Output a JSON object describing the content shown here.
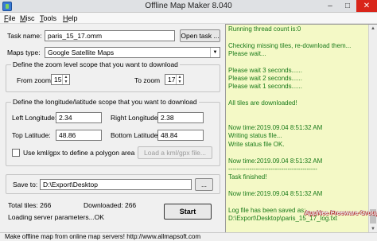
{
  "window": {
    "title": "Offline Map Maker 8.040",
    "minimize": "–",
    "maximize": "□",
    "close": "✕"
  },
  "menu": [
    {
      "mnemonic": "F",
      "rest": "ile"
    },
    {
      "mnemonic": "M",
      "rest": "isc"
    },
    {
      "mnemonic": "T",
      "rest": "ools"
    },
    {
      "mnemonic": "H",
      "rest": "elp"
    }
  ],
  "task": {
    "label": "Task name:",
    "value": "paris_15_17.omm",
    "open_button": "Open task ..."
  },
  "maps_type": {
    "label": "Maps type:",
    "selected": "Google Satellite Maps"
  },
  "zoom": {
    "group_title": "Define the zoom level scope that you want to download",
    "from_label": "From zoom",
    "from_value": "15",
    "to_label": "To zoom",
    "to_value": "17"
  },
  "coords": {
    "group_title": "Define the longitude/latitude scope that you want to download",
    "left_lon_label": "Left Longitude:",
    "left_lon": "2.34",
    "right_lon_label": "Right Longitude:",
    "right_lon": "2.38",
    "top_lat_label": "Top Latitude:",
    "top_lat": "48.86",
    "bottom_lat_label": "Bottom Latitude:",
    "bottom_lat": "48.84",
    "kml_checkbox_label": "Use kml/gpx to define a polygon area",
    "kml_checked": false,
    "kml_button": "Load a kml/gpx file..."
  },
  "save": {
    "label": "Save to:",
    "path": "D:\\Export\\Desktop",
    "browse": "..."
  },
  "stats": {
    "total_tiles": "Total tiles: 266",
    "downloaded": "Downloaded: 266",
    "loading": "Loading server parameters...OK"
  },
  "start_button": "Start",
  "log": [
    "Running thread count is:0",
    "",
    "Checking missing tiles, re-download them...",
    "Please wait...",
    "",
    "Please wait 3 seconds......",
    "Please wait 2 seconds......",
    "Please wait 1 seconds......",
    "",
    "All tiles are downloaded!",
    "",
    "",
    "Now time:2019.09.04  8:51:32 AM",
    "Writing status file...",
    "Write status file OK.",
    "",
    "Now time:2019.09.04  8:51:32 AM",
    "------------------------------------------",
    "Task finished!",
    "",
    "Now time:2019.09.04  8:51:32 AM",
    "",
    "Log file has been saved as:",
    "D:\\Export\\Desktop\\paris_15_17_log.txt",
    "",
    ""
  ],
  "watermark": "AppNee Freeware Group.",
  "status_text": "Make offline map from online map servers!    http://www.allmapsoft.com",
  "colors": {
    "log_bg": "#f4f9c6",
    "log_text": "#1a7a1a",
    "close_btn": "#d9251a"
  }
}
